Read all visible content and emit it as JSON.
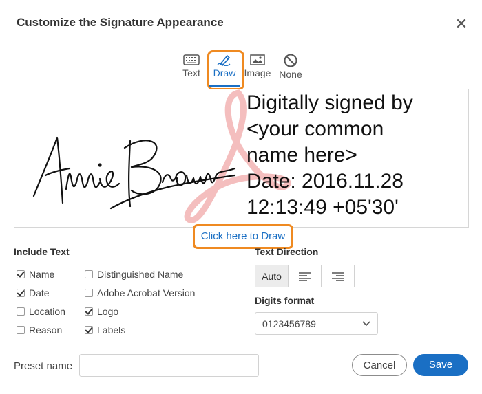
{
  "dialog": {
    "title": "Customize the Signature Appearance",
    "close_icon": "close-icon"
  },
  "modes": [
    {
      "label": "Text",
      "icon": "keyboard-icon",
      "active": false
    },
    {
      "label": "Draw",
      "icon": "pen-icon",
      "active": true
    },
    {
      "label": "Image",
      "icon": "image-icon",
      "active": false
    },
    {
      "label": "None",
      "icon": "no-icon",
      "active": false
    }
  ],
  "preview": {
    "signature_name": "Annie Brown",
    "lines": [
      "Digitally signed by",
      "<your common",
      "name here>",
      "Date: 2016.11.28",
      "12:13:49 +05'30'"
    ]
  },
  "draw_link": "Click here to Draw",
  "include_text": {
    "heading": "Include Text",
    "options": [
      {
        "label": "Name",
        "checked": true
      },
      {
        "label": "Date",
        "checked": true
      },
      {
        "label": "Location",
        "checked": false
      },
      {
        "label": "Reason",
        "checked": false
      },
      {
        "label": "Distinguished Name",
        "checked": false
      },
      {
        "label": "Adobe Acrobat Version",
        "checked": false
      },
      {
        "label": "Logo",
        "checked": true
      },
      {
        "label": "Labels",
        "checked": true
      }
    ]
  },
  "text_direction": {
    "heading": "Text Direction",
    "options": [
      {
        "label": "Auto",
        "active": true
      },
      {
        "label": "",
        "icon": "align-left-icon",
        "active": false
      },
      {
        "label": "",
        "icon": "align-right-icon",
        "active": false
      }
    ]
  },
  "digits_format": {
    "heading": "Digits format",
    "value": "0123456789"
  },
  "preset": {
    "label": "Preset name",
    "value": ""
  },
  "buttons": {
    "cancel": "Cancel",
    "save": "Save"
  },
  "colors": {
    "accent": "#1a6fc4",
    "highlight": "#ef8a21",
    "logo_watermark": "#f2b3b3"
  }
}
